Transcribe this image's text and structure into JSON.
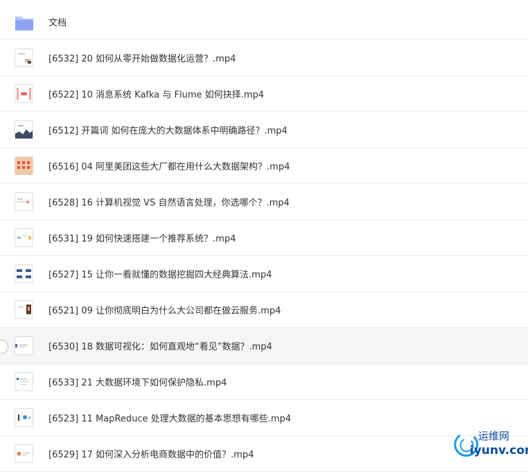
{
  "folder": {
    "label": "文档",
    "icon": "folder-icon"
  },
  "files": [
    {
      "label": "[6532] 20 如何从零开始做数据化运营？.mp4",
      "icon": "video-thumbnail-icon"
    },
    {
      "label": "[6522] 10 消息系统 Kafka 与 Flume 如何抉择.mp4",
      "icon": "video-thumbnail-icon"
    },
    {
      "label": "[6512] 开篇词 如何在庞大的大数据体系中明确路径？.mp4",
      "icon": "video-thumbnail-icon"
    },
    {
      "label": "[6516] 04 阿里美团这些大厂都在用什么大数据架构？.mp4",
      "icon": "video-thumbnail-icon"
    },
    {
      "label": "[6528] 16 计算机视觉 VS 自然语言处理，你选哪个？.mp4",
      "icon": "video-thumbnail-icon"
    },
    {
      "label": "[6531] 19 如何快速搭建一个推荐系统？.mp4",
      "icon": "video-thumbnail-icon"
    },
    {
      "label": "[6527] 15 让你一看就懂的数据挖掘四大经典算法.mp4",
      "icon": "video-thumbnail-icon"
    },
    {
      "label": "[6521] 09 让你彻底明白为什么大公司都在做云服务.mp4",
      "icon": "video-thumbnail-icon"
    },
    {
      "label": "[6530] 18 数据可视化：如何直观地“看见”数据？.mp4",
      "icon": "video-thumbnail-icon"
    },
    {
      "label": "[6533] 21 大数据环境下如何保护隐私.mp4",
      "icon": "video-thumbnail-icon"
    },
    {
      "label": "[6523] 11 MapReduce 处理大数据的基本思想有哪些.mp4",
      "icon": "video-thumbnail-icon"
    },
    {
      "label": "[6529] 17 如何深入分析电商数据中的价值？.mp4",
      "icon": "video-thumbnail-icon"
    }
  ],
  "watermark": {
    "cn": "运维网",
    "en": "iyunv.com"
  },
  "colors": {
    "folder": "#8ea2f5",
    "row_hover": "#f5f5f5",
    "divider": "#ececec",
    "watermark": "#0a4a9a"
  }
}
